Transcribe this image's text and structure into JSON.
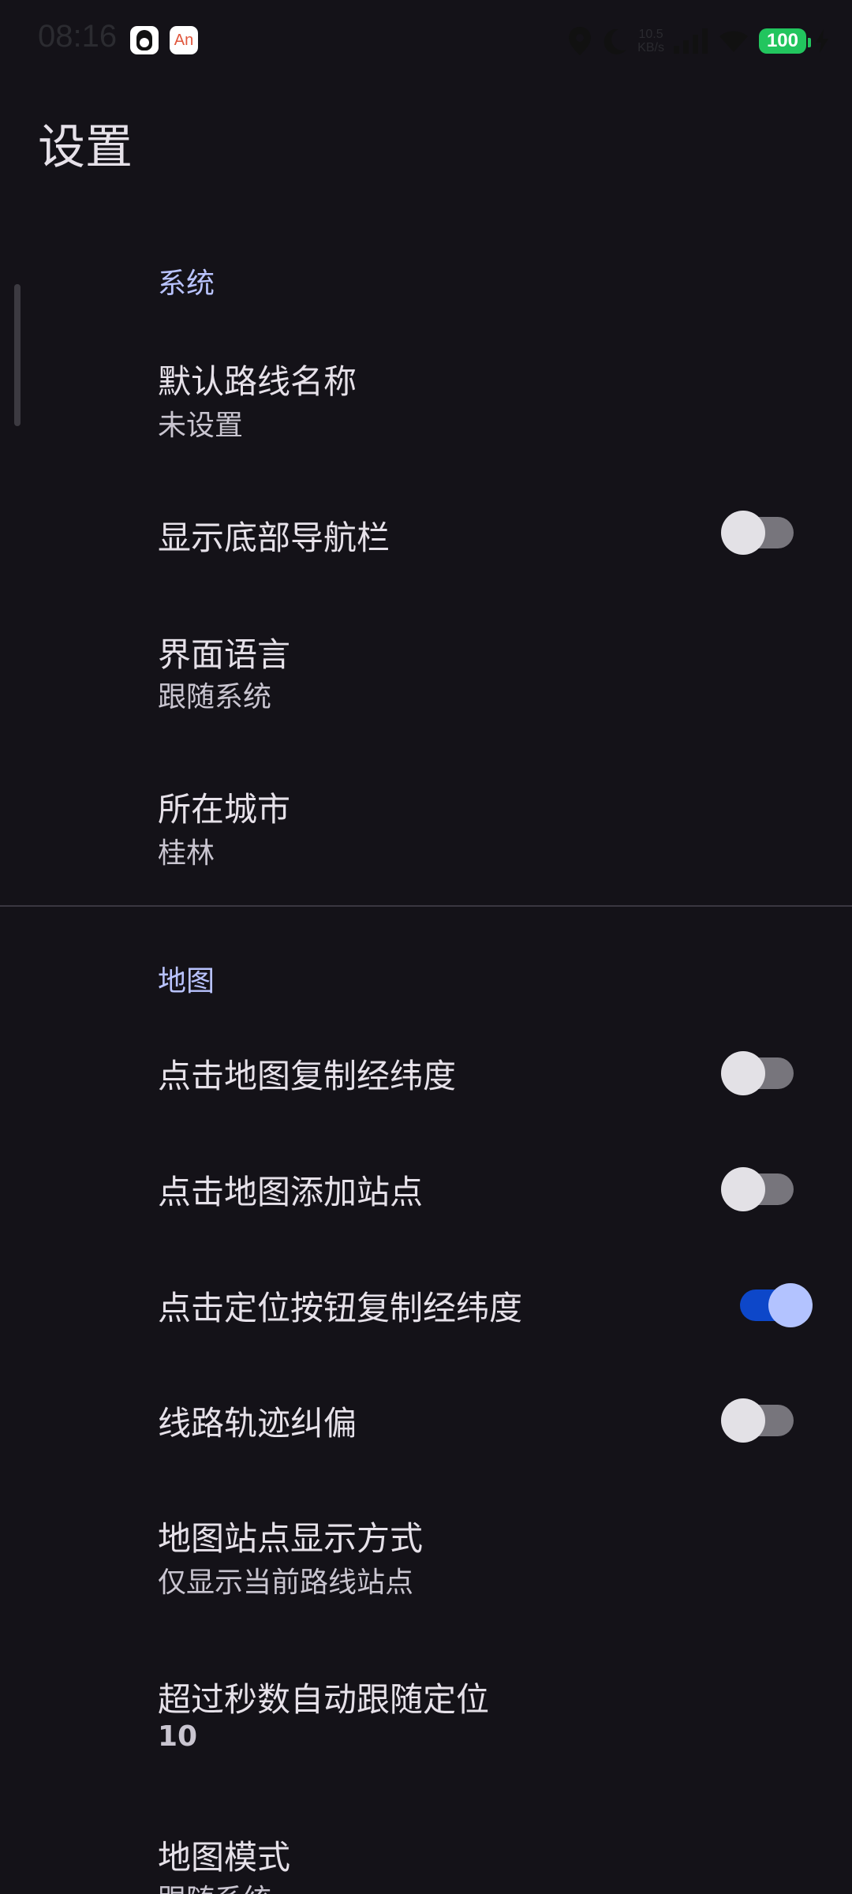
{
  "status_bar": {
    "time": "08:16",
    "app_icon_an": "An",
    "net_speed_value": "10.5",
    "net_speed_unit": "KB/s",
    "battery": "100"
  },
  "page": {
    "title": "设置"
  },
  "sections": {
    "system": {
      "header": "系统",
      "default_route_name": {
        "title": "默认路线名称",
        "value": "未设置"
      },
      "show_bottom_nav": {
        "title": "显示底部导航栏",
        "enabled": false
      },
      "ui_language": {
        "title": "界面语言",
        "value": "跟随系统"
      },
      "city": {
        "title": "所在城市",
        "value": "桂林"
      }
    },
    "map": {
      "header": "地图",
      "tap_map_copy_coords": {
        "title": "点击地图复制经纬度",
        "enabled": false
      },
      "tap_map_add_station": {
        "title": "点击地图添加站点",
        "enabled": false
      },
      "tap_locate_copy_coords": {
        "title": "点击定位按钮复制经纬度",
        "enabled": true
      },
      "route_track_correction": {
        "title": "线路轨迹纠偏",
        "enabled": false
      },
      "station_display_mode": {
        "title": "地图站点显示方式",
        "value": "仅显示当前路线站点"
      },
      "auto_follow_seconds": {
        "title": "超过秒数自动跟随定位",
        "value": "10"
      },
      "map_mode": {
        "title": "地图模式",
        "value": "跟随系统"
      }
    }
  },
  "colors": {
    "background": "#141218",
    "accent_header": "#b9c3ff",
    "switch_on_track": "#0d47c9",
    "switch_on_thumb": "#b3c3ff",
    "battery": "#22c55e"
  }
}
